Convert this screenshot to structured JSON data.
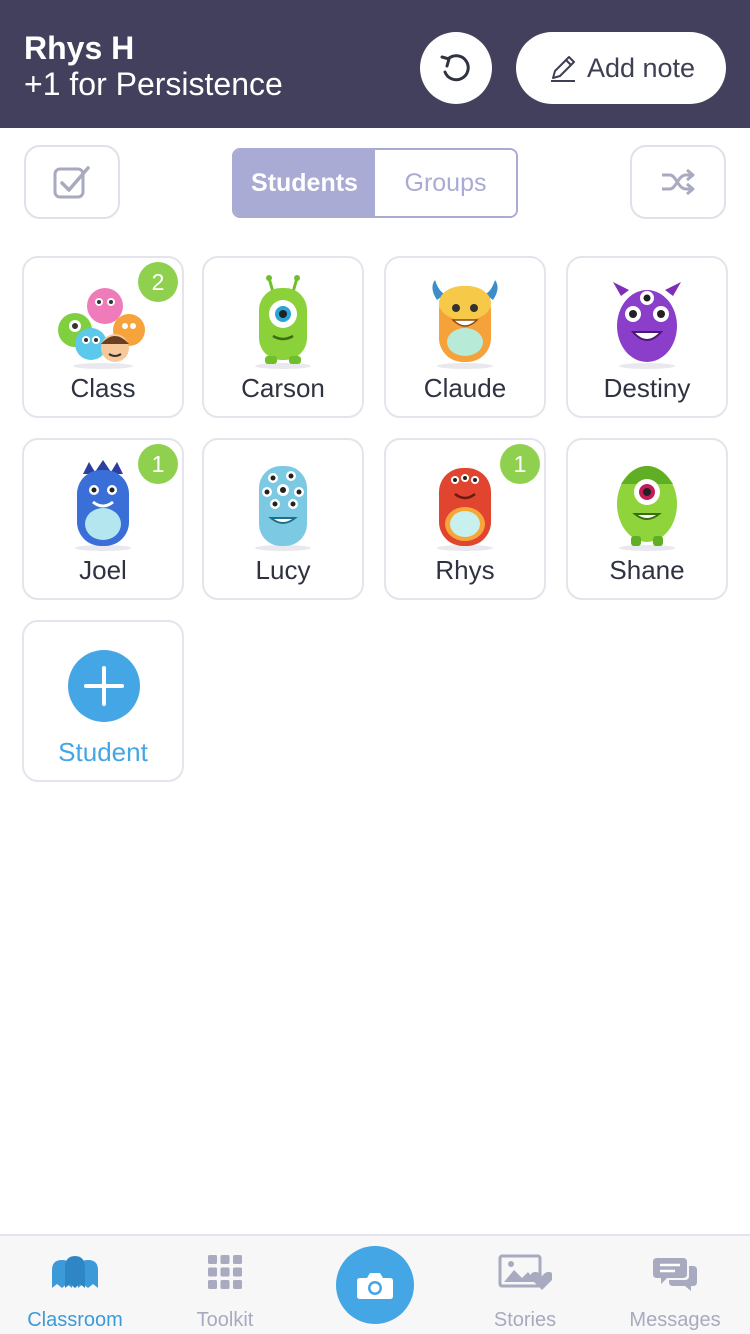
{
  "banner": {
    "name": "Rhys H",
    "subtitle": "+1 for Persistence",
    "undo_icon": "undo-icon",
    "add_note_label": "Add note",
    "add_note_icon": "pencil-icon"
  },
  "toolbar": {
    "select_icon": "checkbox-icon",
    "shuffle_icon": "shuffle-icon",
    "segments": [
      "Students",
      "Groups"
    ],
    "active_segment": "Students"
  },
  "cards": [
    {
      "label": "Class",
      "badge": "2",
      "avatar": "class-group-avatar"
    },
    {
      "label": "Carson",
      "badge": "",
      "avatar": "green-cyclops-monster"
    },
    {
      "label": "Claude",
      "badge": "",
      "avatar": "orange-horned-monster"
    },
    {
      "label": "Destiny",
      "badge": "",
      "avatar": "purple-three-eyed-monster"
    },
    {
      "label": "Joel",
      "badge": "1",
      "avatar": "blue-monster"
    },
    {
      "label": "Lucy",
      "badge": "",
      "avatar": "light-blue-many-eyed-monster"
    },
    {
      "label": "Rhys",
      "badge": "1",
      "avatar": "red-monster"
    },
    {
      "label": "Shane",
      "badge": "",
      "avatar": "lime-cyclops-monster"
    }
  ],
  "add_student": {
    "label": "Student",
    "icon": "plus-icon"
  },
  "nav": {
    "items": [
      {
        "label": "Classroom",
        "icon": "classroom-icon",
        "active": true
      },
      {
        "label": "Toolkit",
        "icon": "grid-icon",
        "active": false
      },
      {
        "label": "Stories",
        "icon": "stories-icon",
        "active": false
      },
      {
        "label": "Messages",
        "icon": "messages-icon",
        "active": false
      }
    ],
    "camera_icon": "camera-icon"
  },
  "colors": {
    "banner": "#43405e",
    "accent": "#45a6e5",
    "segment": "#a9abd4",
    "badge": "#8fd14f"
  }
}
